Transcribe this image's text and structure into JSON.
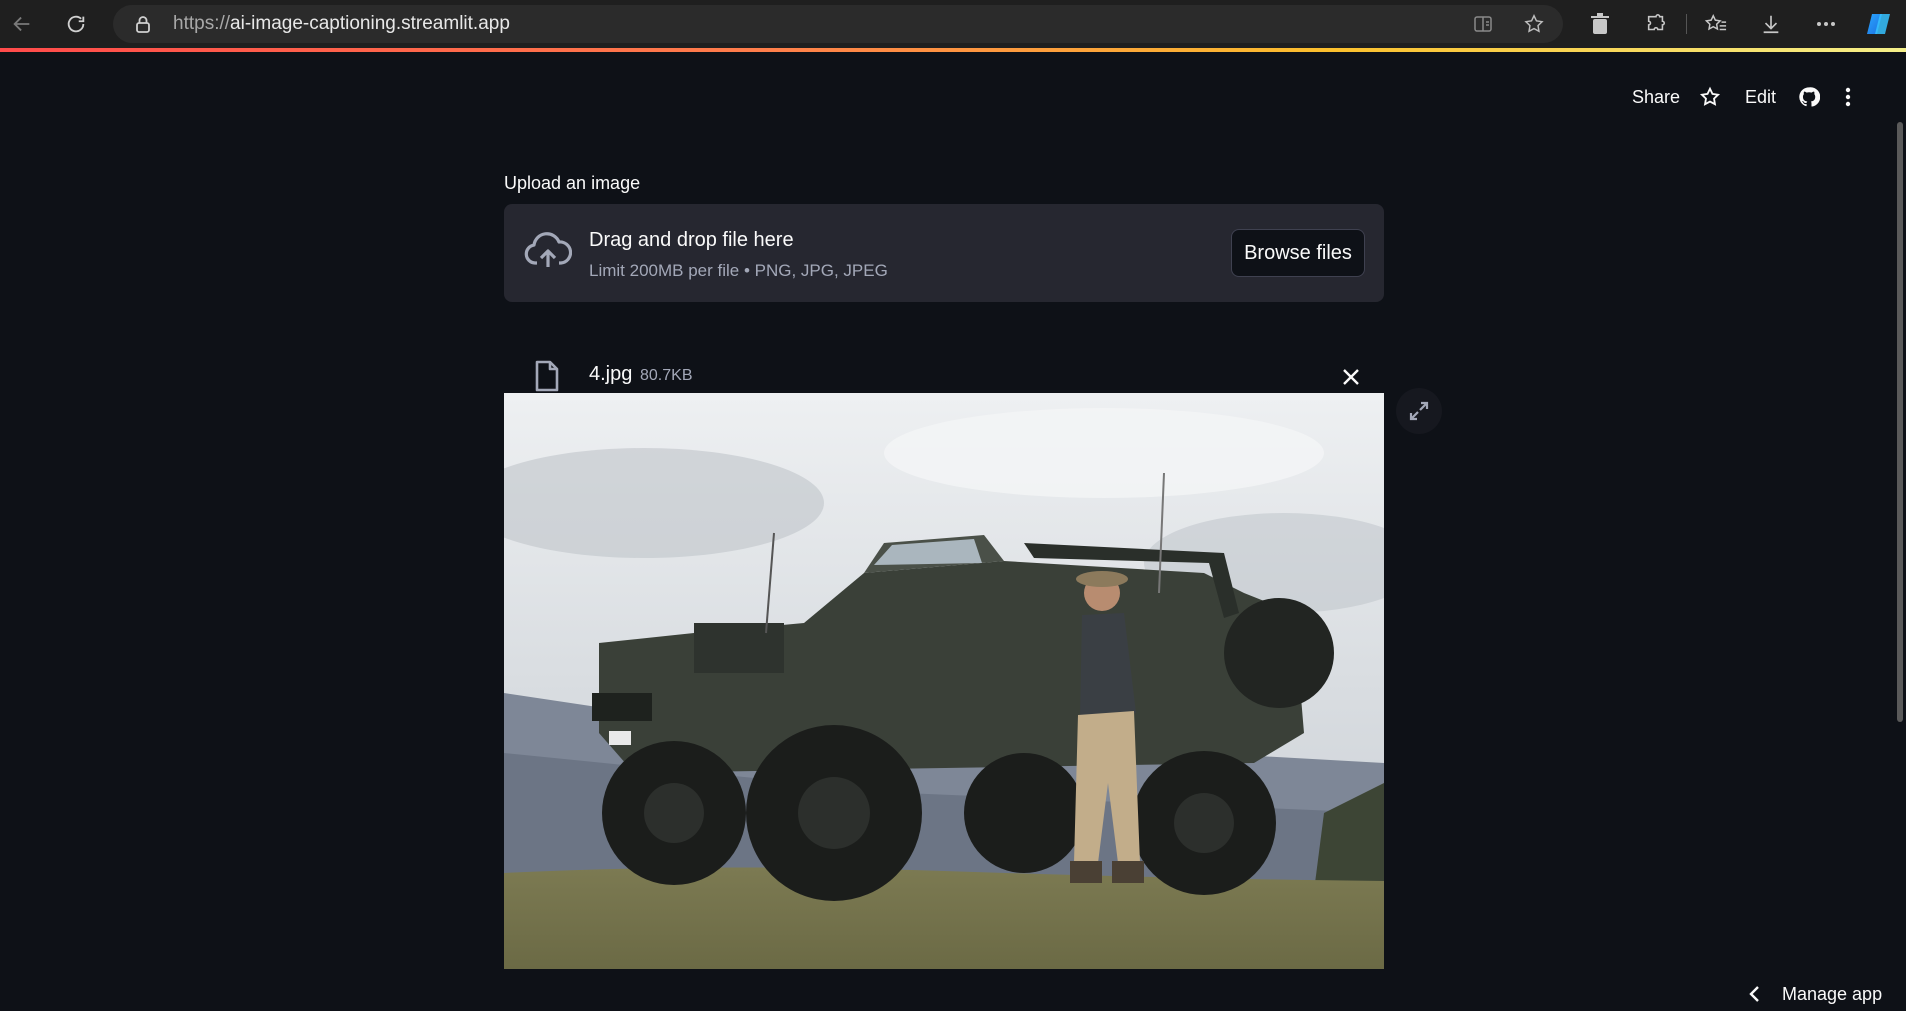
{
  "browser": {
    "url_scheme": "https://",
    "url_host": "ai-image-captioning.streamlit.app"
  },
  "toolbar": {
    "share_label": "Share",
    "edit_label": "Edit"
  },
  "uploader": {
    "label": "Upload an image",
    "drop_title": "Drag and drop file here",
    "drop_limits": "Limit 200MB per file • PNG, JPG, JPEG",
    "browse_label": "Browse files"
  },
  "file": {
    "name": "4.jpg",
    "size": "80.7KB"
  },
  "footer": {
    "manage_label": "Manage app"
  },
  "colors": {
    "background": "#0e1117",
    "surface": "#262730",
    "text": "#fafafa",
    "muted": "#a3a8b8",
    "accent": "#ff4b4b"
  }
}
